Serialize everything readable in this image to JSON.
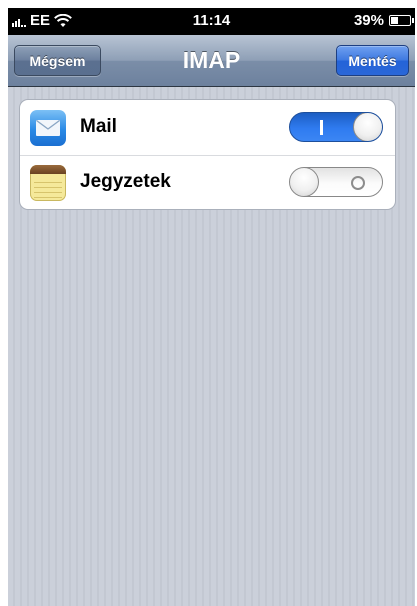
{
  "status_bar": {
    "carrier": "EE",
    "time": "11:14",
    "battery_percent": "39%",
    "battery_level": 0.39,
    "icons": [
      "signal-icon",
      "wifi-icon",
      "battery-icon"
    ]
  },
  "nav": {
    "title": "IMAP",
    "cancel_label": "Mégsem",
    "save_label": "Mentés"
  },
  "settings": {
    "items": [
      {
        "label": "Mail",
        "icon": "mail-icon",
        "enabled": true
      },
      {
        "label": "Jegyzetek",
        "icon": "notes-icon",
        "enabled": false
      }
    ]
  },
  "colors": {
    "toggle_on": "#2f7bf0",
    "save_button": "#2a67d8",
    "nav_bar": "#8e9fb6"
  }
}
